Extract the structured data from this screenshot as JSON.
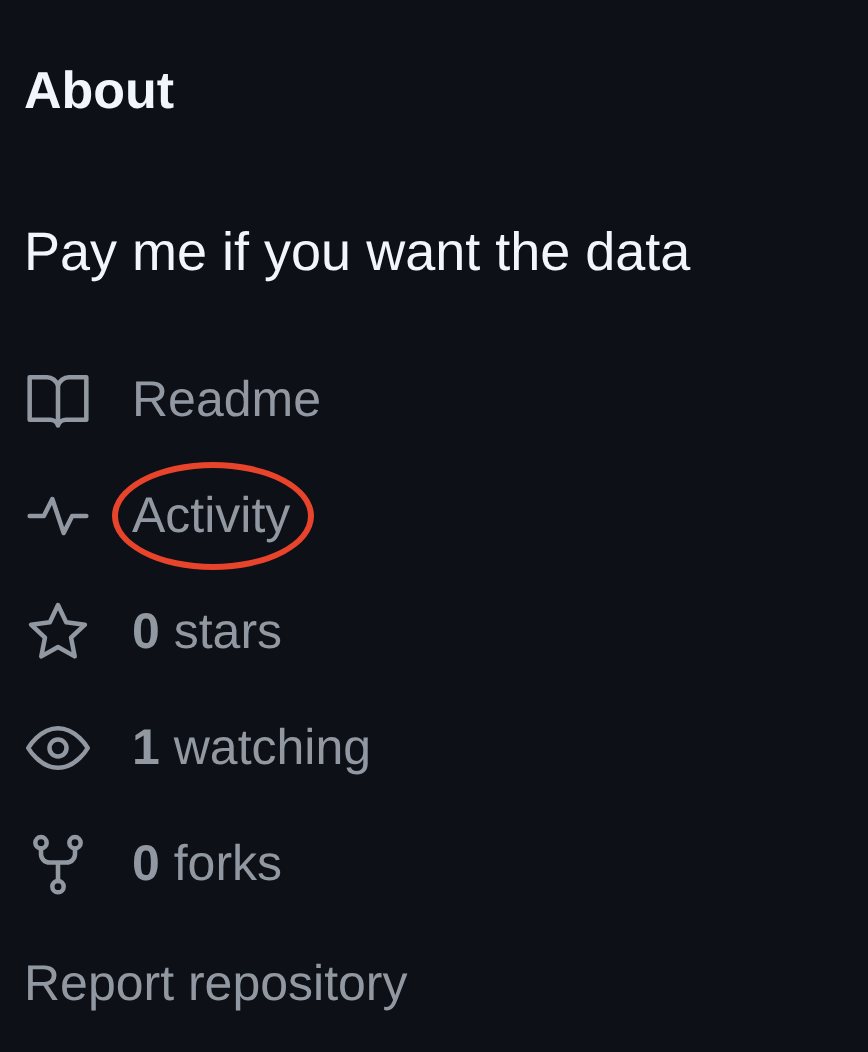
{
  "heading": "About",
  "description": "Pay me if you want the data",
  "links": [
    {
      "kind": "book",
      "label": "Readme",
      "circled": false
    },
    {
      "kind": "pulse",
      "label": "Activity",
      "circled": true
    },
    {
      "kind": "star",
      "count": "0",
      "label": "stars",
      "circled": false
    },
    {
      "kind": "eye",
      "count": "1",
      "label": "watching",
      "circled": false
    },
    {
      "kind": "fork",
      "count": "0",
      "label": "forks",
      "circled": false
    }
  ],
  "report_link": "Report repository"
}
